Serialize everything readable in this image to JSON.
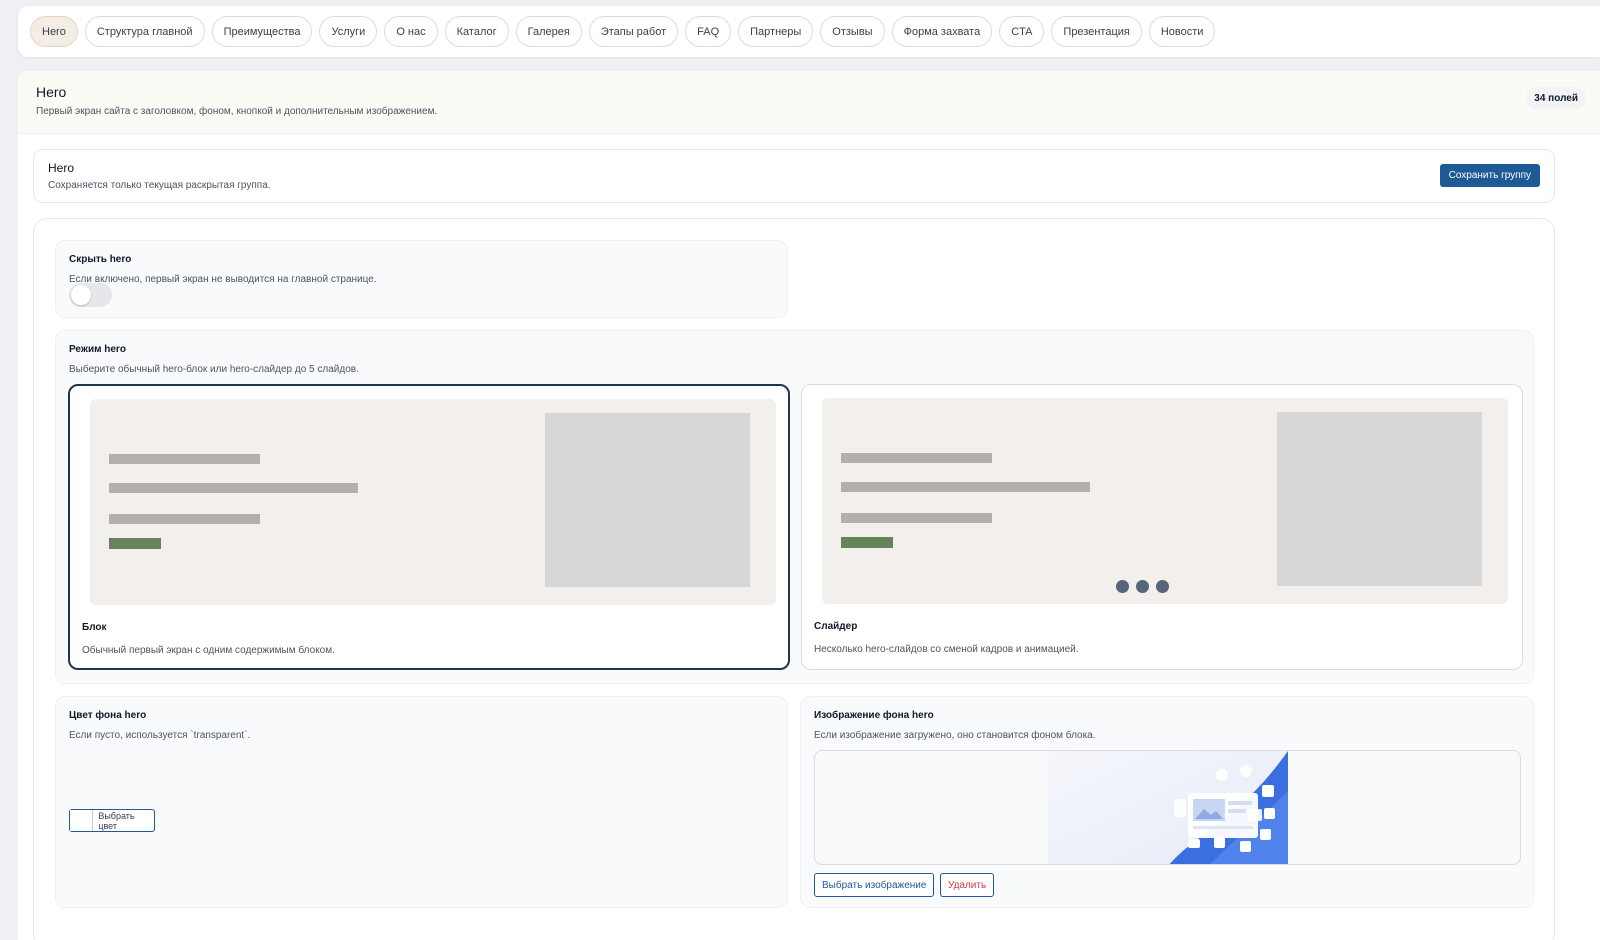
{
  "tabs": [
    {
      "label": "Hero",
      "active": true
    },
    {
      "label": "Структура главной"
    },
    {
      "label": "Преимущества"
    },
    {
      "label": "Услуги"
    },
    {
      "label": "О нас"
    },
    {
      "label": "Каталог"
    },
    {
      "label": "Галерея"
    },
    {
      "label": "Этапы работ"
    },
    {
      "label": "FAQ"
    },
    {
      "label": "Партнеры"
    },
    {
      "label": "Отзывы"
    },
    {
      "label": "Форма захвата"
    },
    {
      "label": "CTA"
    },
    {
      "label": "Презентация"
    },
    {
      "label": "Новости"
    }
  ],
  "section": {
    "title": "Hero",
    "description": "Первый экран сайта с заголовком, фоном, кнопкой и дополнительным изображением.",
    "count": "34 полей"
  },
  "group": {
    "title": "Hero",
    "description": "Сохраняется только текущая раскрытая группа.",
    "save_label": "Сохранить группу"
  },
  "fields": {
    "hide_hero": {
      "label": "Скрыть hero",
      "description": "Если включено, первый экран не выводится на главной странице.",
      "enabled": false
    },
    "hero_mode": {
      "label": "Режим hero",
      "description": "Выберите обычный hero-блок или hero-слайдер до 5 слайдов.",
      "options": [
        {
          "title": "Блок",
          "description": "Обычный первый экран с одним содержимым блоком.",
          "selected": true
        },
        {
          "title": "Слайдер",
          "description": "Несколько hero-слайдов со сменой кадров и анимацией.",
          "selected": false
        }
      ]
    },
    "hero_bg_color": {
      "label": "Цвет фона hero",
      "description": "Если пусто, используется `transparent`.",
      "button_label": "Выбрать цвет"
    },
    "hero_bg_image": {
      "label": "Изображение фона hero",
      "description": "Если изображение загружено, оно становится фоном блока.",
      "choose_label": "Выбрать изображение",
      "delete_label": "Удалить"
    }
  },
  "colors": {
    "accent": "#1e5a96",
    "active_tab": "#f4ede4",
    "danger": "#d23b3b",
    "preview_button": "#65845a"
  }
}
